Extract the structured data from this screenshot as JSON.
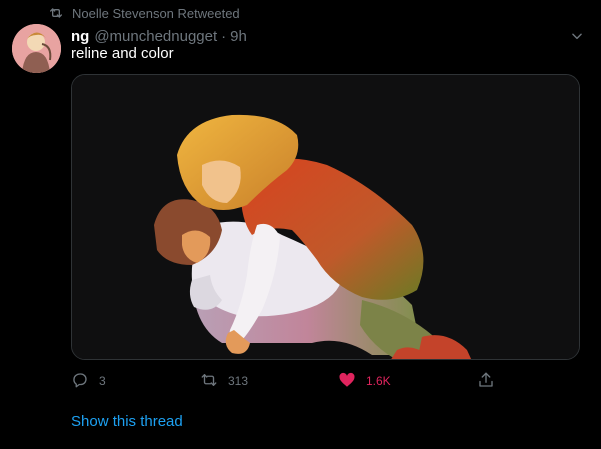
{
  "context": {
    "retweeted_by": "Noelle Stevenson Retweeted"
  },
  "tweet": {
    "display_name": "ng",
    "handle": "@munchednugget",
    "separator": "·",
    "time": "9h",
    "text": "reline and color"
  },
  "actions": {
    "reply_count": "3",
    "retweet_count": "313",
    "like_count": "1.6K"
  },
  "show_thread": "Show this thread",
  "colors": {
    "background": "#000000",
    "secondary_text": "#6e767d",
    "link": "#1da1f2",
    "like": "#e0245e"
  }
}
